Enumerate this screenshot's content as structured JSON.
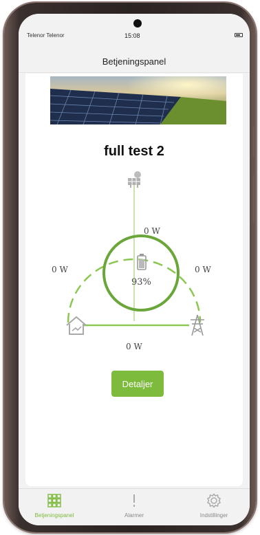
{
  "status_bar": {
    "carrier": "Telenor Telenor",
    "time": "15:08"
  },
  "header": {
    "title": "Betjeningspanel"
  },
  "site": {
    "name": "full test 2"
  },
  "energy_flow": {
    "solar_to_battery": "0 W",
    "house_to_battery": "0 W",
    "grid_to_battery": "0 W",
    "house_to_grid": "0 W",
    "battery_soc": "93%"
  },
  "actions": {
    "details_label": "Detaljer"
  },
  "tabbar": {
    "tabs": [
      {
        "label": "Betjeningspanel",
        "icon": "grid-icon",
        "active": true
      },
      {
        "label": "Alarmer",
        "icon": "alert-icon",
        "active": false
      },
      {
        "label": "Indstillinger",
        "icon": "gear-icon",
        "active": false
      }
    ]
  },
  "colors": {
    "accent": "#7dbb3c",
    "battery_ring": "#6aa63a"
  }
}
